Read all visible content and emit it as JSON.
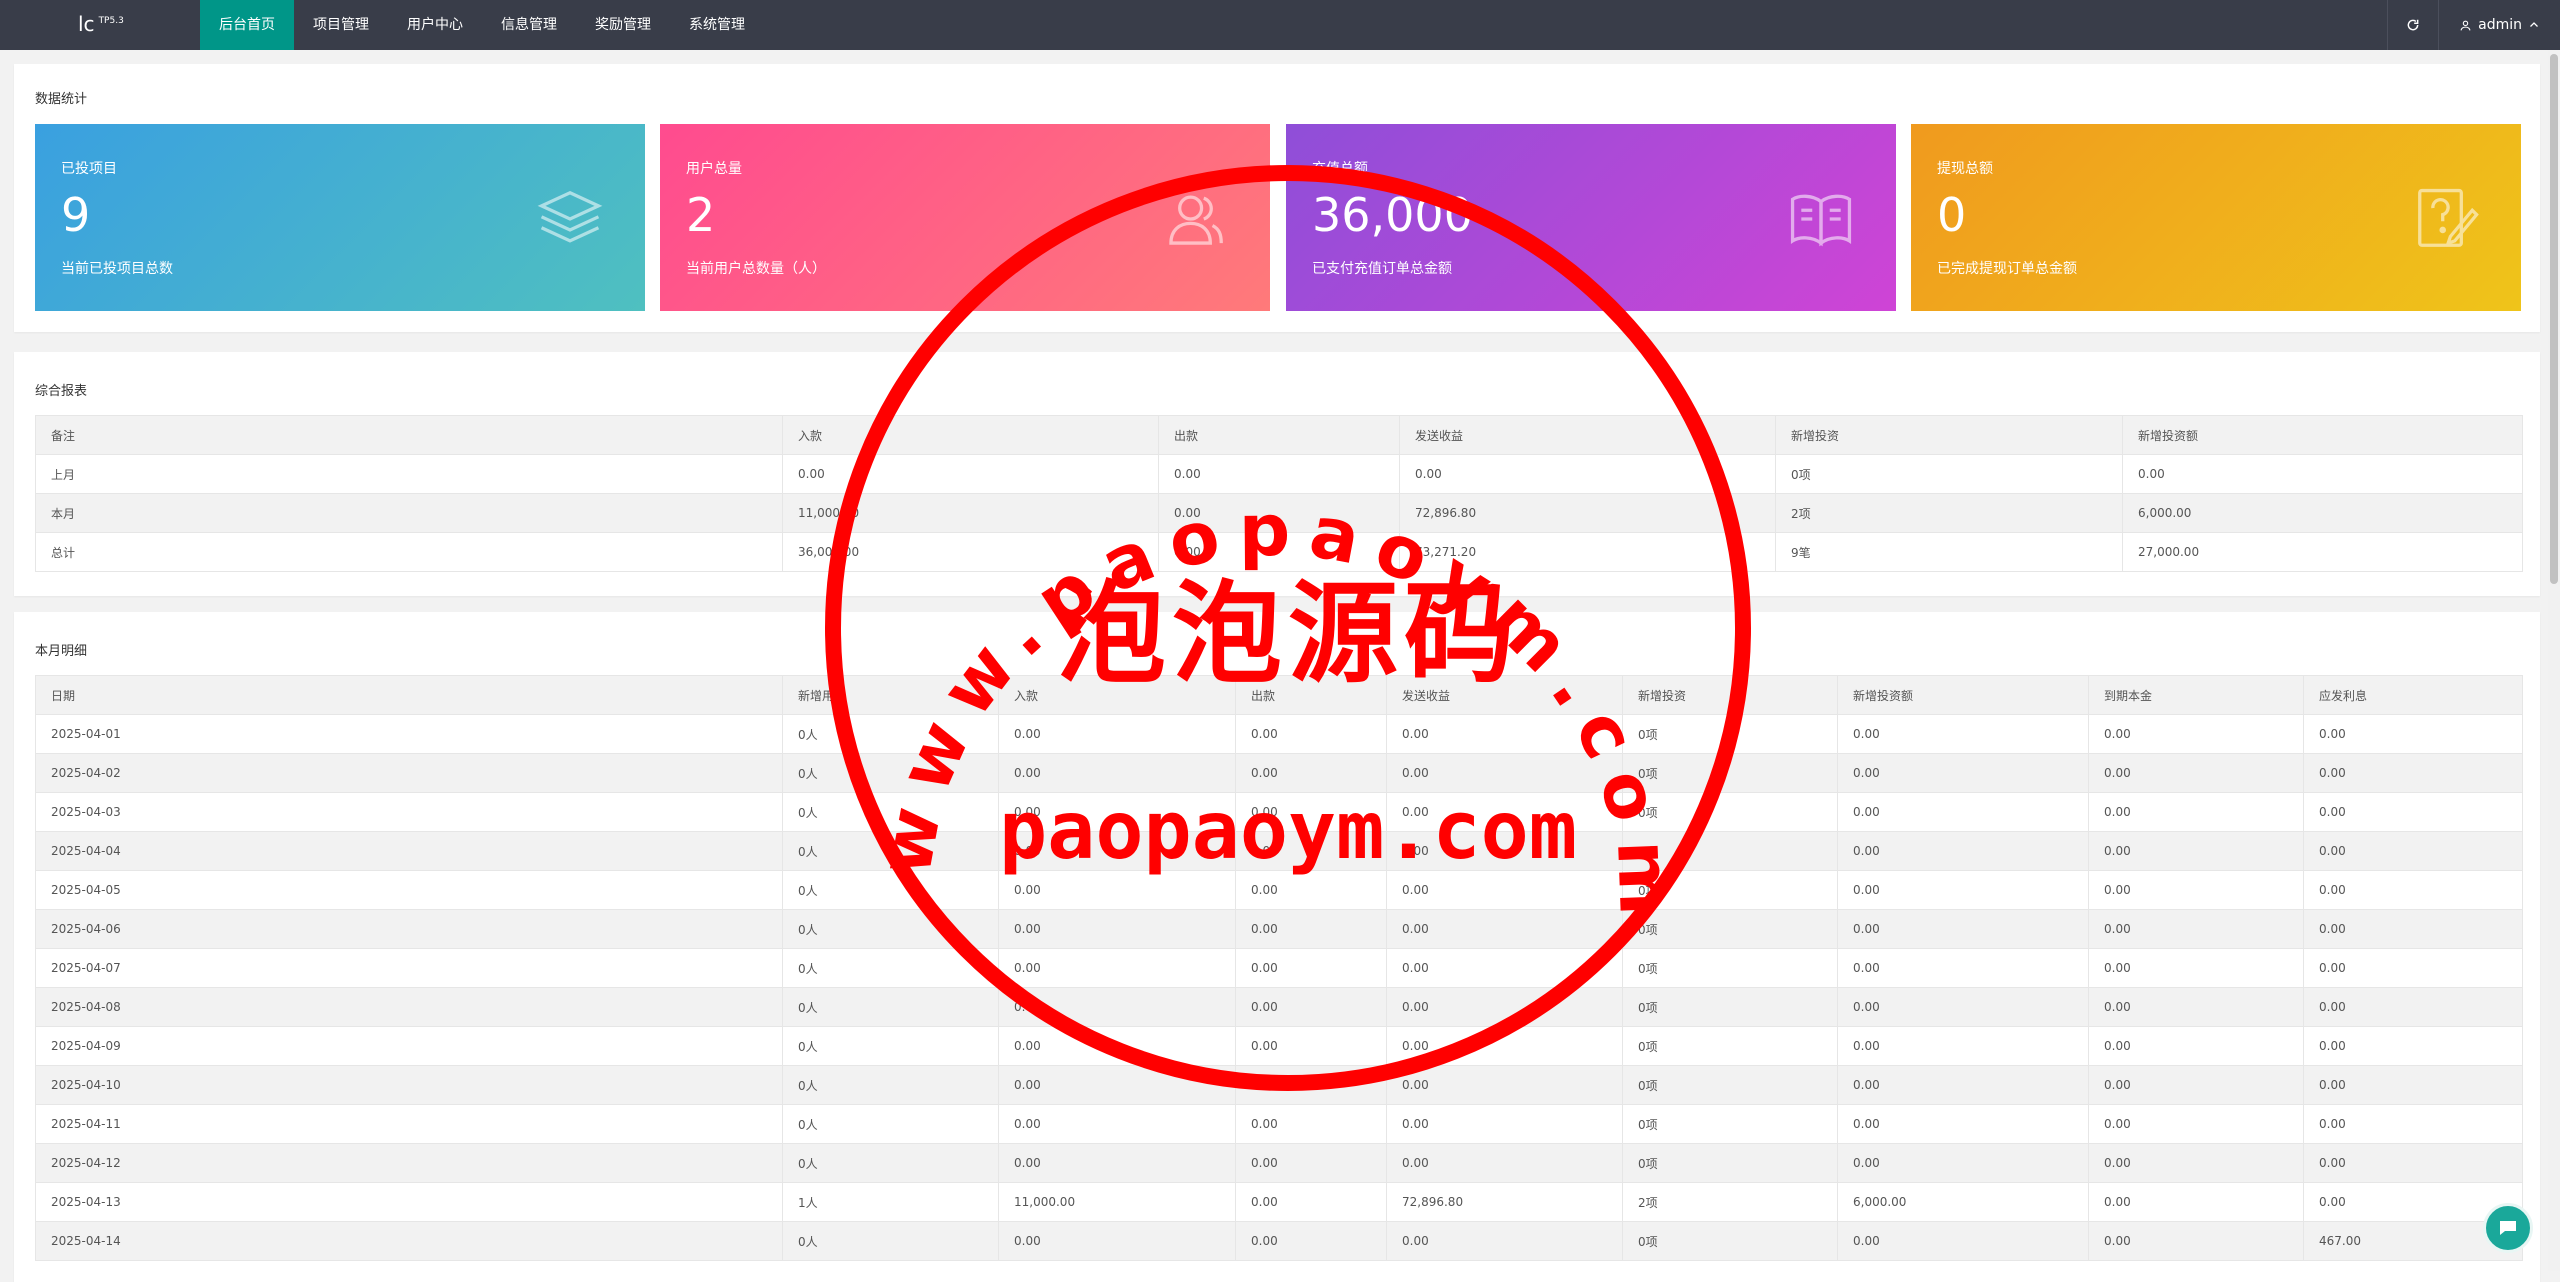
{
  "topbar": {
    "logo": "lc",
    "logo_version": "TP5.3",
    "nav": [
      "后台首页",
      "项目管理",
      "用户中心",
      "信息管理",
      "奖励管理",
      "系统管理"
    ],
    "user": "admin"
  },
  "stats": {
    "title": "数据统计",
    "cards": [
      {
        "label": "已投项目",
        "value": "9",
        "desc": "当前已投项目总数"
      },
      {
        "label": "用户总量",
        "value": "2",
        "desc": "当前用户总数量（人）"
      },
      {
        "label": "充值总额",
        "value": "36,000",
        "desc": "已支付充值订单总金额"
      },
      {
        "label": "提现总额",
        "value": "0",
        "desc": "已完成提现订单总金额"
      }
    ]
  },
  "report": {
    "title": "综合报表",
    "headers": [
      "备注",
      "入款",
      "出款",
      "发送收益",
      "新增投资",
      "新增投资额"
    ],
    "rows": [
      [
        "上月",
        "0.00",
        "0.00",
        "0.00",
        "0项",
        "0.00"
      ],
      [
        "本月",
        "11,000.00",
        "0.00",
        "72,896.80",
        "2项",
        "6,000.00"
      ],
      [
        "总计",
        "36,000.00",
        "0.00",
        "73,271.20",
        "9笔",
        "27,000.00"
      ]
    ]
  },
  "monthly": {
    "title": "本月明细",
    "headers": [
      "日期",
      "新增用户",
      "入款",
      "出款",
      "发送收益",
      "新增投资",
      "新增投资额",
      "到期本金",
      "应发利息"
    ],
    "rows": [
      [
        "2025-04-01",
        "0人",
        "0.00",
        "0.00",
        "0.00",
        "0项",
        "0.00",
        "0.00",
        "0.00"
      ],
      [
        "2025-04-02",
        "0人",
        "0.00",
        "0.00",
        "0.00",
        "0项",
        "0.00",
        "0.00",
        "0.00"
      ],
      [
        "2025-04-03",
        "0人",
        "0.00",
        "0.00",
        "0.00",
        "0项",
        "0.00",
        "0.00",
        "0.00"
      ],
      [
        "2025-04-04",
        "0人",
        "0.00",
        "0.00",
        "0.00",
        "0项",
        "0.00",
        "0.00",
        "0.00"
      ],
      [
        "2025-04-05",
        "0人",
        "0.00",
        "0.00",
        "0.00",
        "0项",
        "0.00",
        "0.00",
        "0.00"
      ],
      [
        "2025-04-06",
        "0人",
        "0.00",
        "0.00",
        "0.00",
        "0项",
        "0.00",
        "0.00",
        "0.00"
      ],
      [
        "2025-04-07",
        "0人",
        "0.00",
        "0.00",
        "0.00",
        "0项",
        "0.00",
        "0.00",
        "0.00"
      ],
      [
        "2025-04-08",
        "0人",
        "0.00",
        "0.00",
        "0.00",
        "0项",
        "0.00",
        "0.00",
        "0.00"
      ],
      [
        "2025-04-09",
        "0人",
        "0.00",
        "0.00",
        "0.00",
        "0项",
        "0.00",
        "0.00",
        "0.00"
      ],
      [
        "2025-04-10",
        "0人",
        "0.00",
        "0.00",
        "0.00",
        "0项",
        "0.00",
        "0.00",
        "0.00"
      ],
      [
        "2025-04-11",
        "0人",
        "0.00",
        "0.00",
        "0.00",
        "0项",
        "0.00",
        "0.00",
        "0.00"
      ],
      [
        "2025-04-12",
        "0人",
        "0.00",
        "0.00",
        "0.00",
        "0项",
        "0.00",
        "0.00",
        "0.00"
      ],
      [
        "2025-04-13",
        "1人",
        "11,000.00",
        "0.00",
        "72,896.80",
        "2项",
        "6,000.00",
        "0.00",
        "0.00"
      ],
      [
        "2025-04-14",
        "0人",
        "0.00",
        "0.00",
        "0.00",
        "0项",
        "0.00",
        "0.00",
        "467.00"
      ]
    ]
  },
  "watermark": {
    "ring_text": "www.paopaoym.com",
    "center_text": "泡泡源码",
    "bottom_text": "paopaoym.com",
    "color": "#ff0000"
  }
}
